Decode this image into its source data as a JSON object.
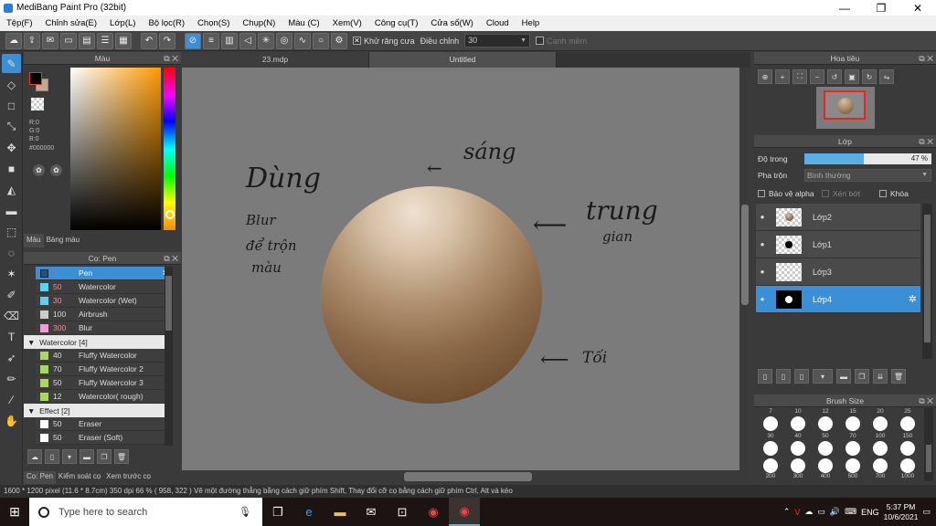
{
  "window": {
    "title": "MediBang Paint Pro (32bit)",
    "minimize": "—",
    "restore": "❐",
    "close": "✕"
  },
  "menu": [
    "Tệp(F)",
    "Chỉnh sửa(E)",
    "Lớp(L)",
    "Bộ lọc(R)",
    "Chọn(S)",
    "Chụp(N)",
    "Màu (C)",
    "Xem(V)",
    "Công cụ(T)",
    "Cửa sổ(W)",
    "Cloud",
    "Help"
  ],
  "toolbar": {
    "antialias_label": "Khử răng cưa",
    "antialias_checked": "✕",
    "correction_label": "Điều chỉnh",
    "correction_value": "30",
    "snap_label": "Canh mềm"
  },
  "color_panel": {
    "title": "Màu",
    "rgb": "R:0\nG:0\nB:0",
    "hex": "#000000",
    "tabs": [
      "Màu",
      "Bảng màu"
    ]
  },
  "brush_panel": {
    "title": "Cọ: Pen",
    "brushes": [
      {
        "size": "2",
        "name": "Pen",
        "color": "#2a4f7a",
        "selected": true
      },
      {
        "size": "50",
        "name": "Watercolor",
        "color": "#5fd0f0"
      },
      {
        "size": "30",
        "name": "Watercolor (Wet)",
        "color": "#5fd0f0"
      },
      {
        "size": "100",
        "name": "Airbrush",
        "color": "#cccccc"
      },
      {
        "size": "300",
        "name": "Blur",
        "color": "#f59ad6"
      }
    ],
    "group1": "Watercolor [4]",
    "group1_items": [
      {
        "size": "40",
        "name": "Fluffy Watercolor",
        "color": "#a8d860"
      },
      {
        "size": "70",
        "name": "Fluffy Watercolor 2",
        "color": "#a8d860"
      },
      {
        "size": "50",
        "name": "Fluffy Watercolor 3",
        "color": "#a8d860"
      },
      {
        "size": "12",
        "name": "Watercolor( rough)",
        "color": "#a8d860"
      }
    ],
    "group2": "Effect [2]",
    "group2_items": [
      {
        "size": "50",
        "name": "Eraser",
        "color": "#ffffff"
      },
      {
        "size": "50",
        "name": "Eraser (Soft)",
        "color": "#ffffff"
      }
    ]
  },
  "left_tabs": [
    "Cọ: Pen",
    "Kiểm soát cọ",
    "Xem trước cọ"
  ],
  "doc_tabs": [
    "23.mdp",
    "Untitled"
  ],
  "canvas_text": {
    "dung": "Dùng",
    "blur": "Blur",
    "de_tron": "để trộn",
    "mau": "màu",
    "sang": "sáng",
    "trung": "trung",
    "gian": "gian",
    "toi": "Tối"
  },
  "navigator": {
    "title": "Hoa tiêu"
  },
  "layer_panel": {
    "title": "Lớp",
    "opacity_label": "Độ trong",
    "opacity_value": "47 %",
    "opacity_fraction": 0.47,
    "blend_label": "Pha trộn",
    "blend_value": "Bình thường",
    "protect_alpha": "Bảo vệ alpha",
    "clipping": "Xén bớt",
    "lock": "Khóa",
    "layers": [
      {
        "name": "Lớp2",
        "thumb": "ball",
        "selected": false
      },
      {
        "name": "Lớp1",
        "thumb": "dot",
        "selected": false
      },
      {
        "name": "Lớp3",
        "thumb": "empty",
        "selected": false
      },
      {
        "name": "Lớp4",
        "thumb": "black",
        "selected": true
      }
    ]
  },
  "brush_size": {
    "title": "Brush Size",
    "row1": [
      "7",
      "10",
      "12",
      "15",
      "20",
      "25"
    ],
    "row2": [
      "30",
      "40",
      "50",
      "70",
      "100",
      "150"
    ],
    "row3": [
      "200",
      "300",
      "400",
      "500",
      "700",
      "1000"
    ]
  },
  "status": "1600 * 1200 pixel  (11.6 * 8.7cm)  350 dpi  66 %  ( 958, 322 )  Vẽ một đường thẳng bằng cách giữ phím Shift, Thay đổi cỡ cọ bằng cách giữ phím Ctrl, Alt và kéo",
  "taskbar": {
    "search_placeholder": "Type here to search",
    "lang": "ENG",
    "time": "5:37 PM",
    "date": "10/6/2021"
  }
}
